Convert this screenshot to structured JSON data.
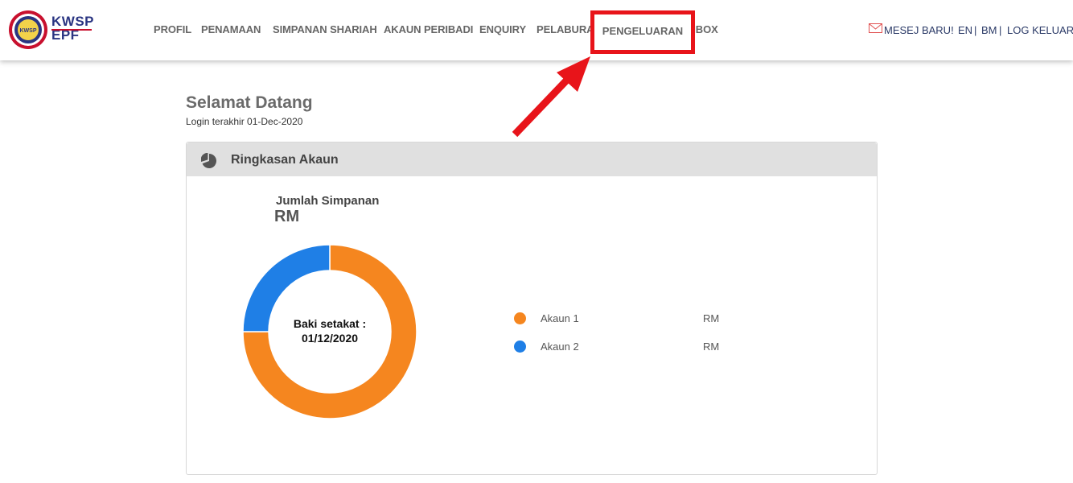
{
  "brand": {
    "line1": "KWSP",
    "line2": "EPF",
    "emblem_text": "KWSP"
  },
  "nav": {
    "items": [
      "PROFIL",
      "PENAMAAN",
      "SIMPANAN SHARIAH",
      "AKAUN PERIBADI",
      "ENQUIRY",
      "PELABURAN",
      "PENGELUARAN",
      "INBOX"
    ],
    "highlighted": "PENGELUARAN"
  },
  "top_right": {
    "message": "MESEJ BARU!",
    "lang_en": "EN",
    "sep1": "|",
    "lang_bm": "BM",
    "sep2": "|",
    "logout": "LOG KELUAR"
  },
  "welcome": {
    "title": "Selamat Datang",
    "last_login": "Login terakhir 01-Dec-2020"
  },
  "panel": {
    "title": "Ringkasan Akaun",
    "total_label": "Jumlah Simpanan",
    "total_value": "RM",
    "donut_center_line1": "Baki setakat :",
    "donut_center_line2": "01/12/2020"
  },
  "legend": [
    {
      "name": "Akaun 1",
      "value": "RM",
      "color": "#f5861f"
    },
    {
      "name": "Akaun 2",
      "value": "RM",
      "color": "#1f7fe6"
    }
  ],
  "chart_data": {
    "type": "pie",
    "categories": [
      "Akaun 1",
      "Akaun 2"
    ],
    "values": [
      75,
      25
    ],
    "colors": [
      "#f5861f",
      "#1f7fe6"
    ]
  },
  "colors": {
    "highlight": "#e8141a",
    "brand": "#2a3582",
    "accent_red": "#c8102e"
  }
}
